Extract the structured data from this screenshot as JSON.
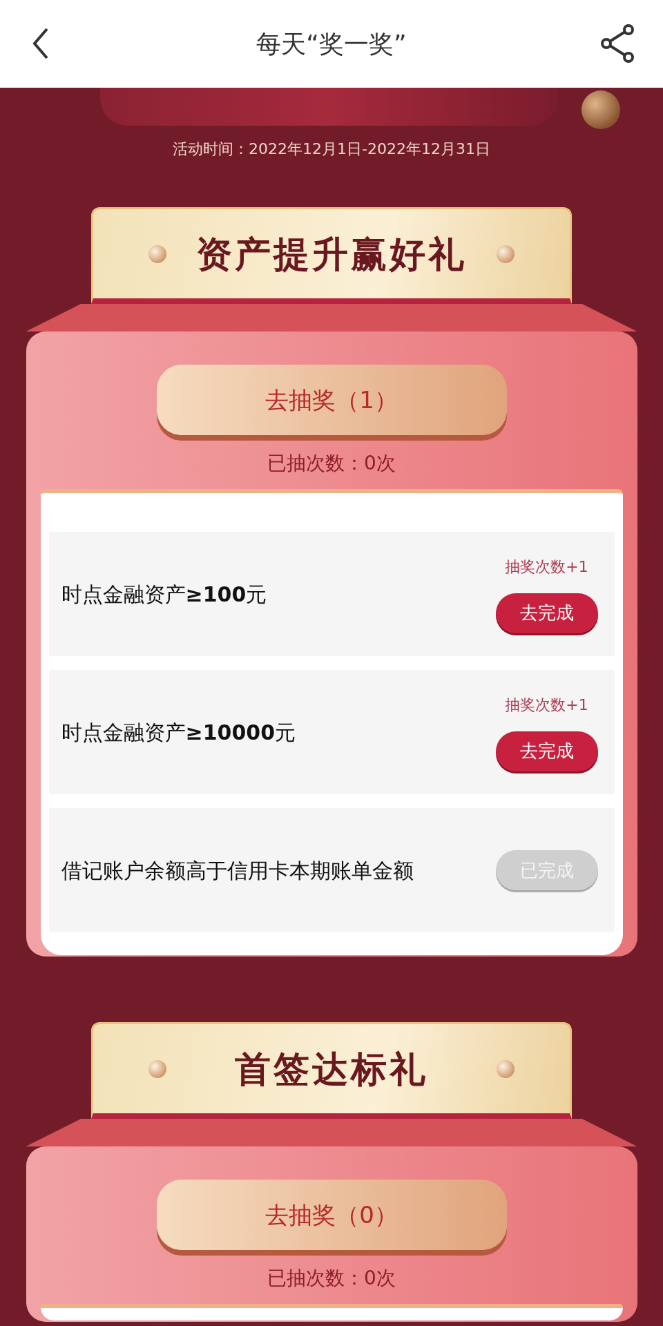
{
  "header": {
    "title": "每天“奖一奖”"
  },
  "banner": {
    "date_text": "活动时间：2022年12月1日-2022年12月31日"
  },
  "sections": [
    {
      "title": "资产提升赢好礼",
      "draw_button": "去抽奖（1）",
      "draw_count": "已抽次数：0次",
      "tasks": [
        {
          "label": "时点金融资产**≥100**元",
          "reward": "抽奖次数+1",
          "button": "去完成",
          "completed": false
        },
        {
          "label": "时点金融资产**≥10000**元",
          "reward": "抽奖次数+1",
          "button": "去完成",
          "completed": false
        },
        {
          "label": "借记账户余额高于信用卡本期账单金额",
          "button": "已完成",
          "completed": true
        }
      ]
    },
    {
      "title": "首签达标礼",
      "draw_button": "去抽奖（0）",
      "draw_count": "已抽次数：0次"
    }
  ]
}
